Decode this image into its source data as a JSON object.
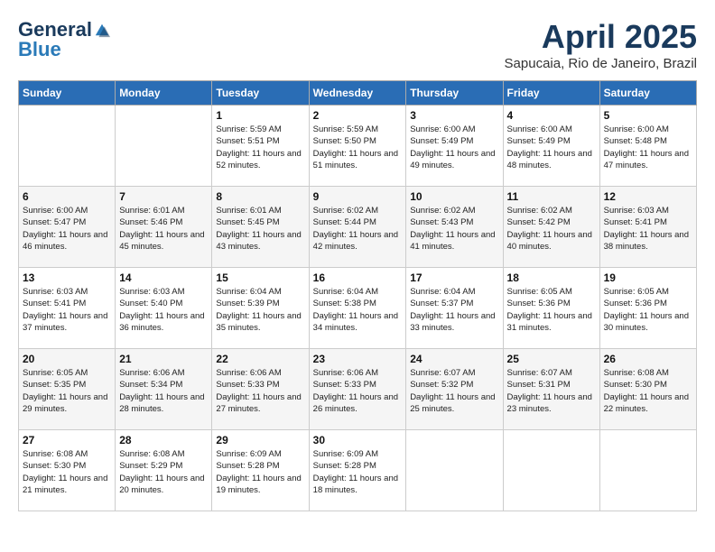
{
  "header": {
    "logo_general": "General",
    "logo_blue": "Blue",
    "month_title": "April 2025",
    "location": "Sapucaia, Rio de Janeiro, Brazil"
  },
  "weekdays": [
    "Sunday",
    "Monday",
    "Tuesday",
    "Wednesday",
    "Thursday",
    "Friday",
    "Saturday"
  ],
  "weeks": [
    [
      {
        "day": "",
        "info": ""
      },
      {
        "day": "",
        "info": ""
      },
      {
        "day": "1",
        "info": "Sunrise: 5:59 AM\nSunset: 5:51 PM\nDaylight: 11 hours and 52 minutes."
      },
      {
        "day": "2",
        "info": "Sunrise: 5:59 AM\nSunset: 5:50 PM\nDaylight: 11 hours and 51 minutes."
      },
      {
        "day": "3",
        "info": "Sunrise: 6:00 AM\nSunset: 5:49 PM\nDaylight: 11 hours and 49 minutes."
      },
      {
        "day": "4",
        "info": "Sunrise: 6:00 AM\nSunset: 5:49 PM\nDaylight: 11 hours and 48 minutes."
      },
      {
        "day": "5",
        "info": "Sunrise: 6:00 AM\nSunset: 5:48 PM\nDaylight: 11 hours and 47 minutes."
      }
    ],
    [
      {
        "day": "6",
        "info": "Sunrise: 6:00 AM\nSunset: 5:47 PM\nDaylight: 11 hours and 46 minutes."
      },
      {
        "day": "7",
        "info": "Sunrise: 6:01 AM\nSunset: 5:46 PM\nDaylight: 11 hours and 45 minutes."
      },
      {
        "day": "8",
        "info": "Sunrise: 6:01 AM\nSunset: 5:45 PM\nDaylight: 11 hours and 43 minutes."
      },
      {
        "day": "9",
        "info": "Sunrise: 6:02 AM\nSunset: 5:44 PM\nDaylight: 11 hours and 42 minutes."
      },
      {
        "day": "10",
        "info": "Sunrise: 6:02 AM\nSunset: 5:43 PM\nDaylight: 11 hours and 41 minutes."
      },
      {
        "day": "11",
        "info": "Sunrise: 6:02 AM\nSunset: 5:42 PM\nDaylight: 11 hours and 40 minutes."
      },
      {
        "day": "12",
        "info": "Sunrise: 6:03 AM\nSunset: 5:41 PM\nDaylight: 11 hours and 38 minutes."
      }
    ],
    [
      {
        "day": "13",
        "info": "Sunrise: 6:03 AM\nSunset: 5:41 PM\nDaylight: 11 hours and 37 minutes."
      },
      {
        "day": "14",
        "info": "Sunrise: 6:03 AM\nSunset: 5:40 PM\nDaylight: 11 hours and 36 minutes."
      },
      {
        "day": "15",
        "info": "Sunrise: 6:04 AM\nSunset: 5:39 PM\nDaylight: 11 hours and 35 minutes."
      },
      {
        "day": "16",
        "info": "Sunrise: 6:04 AM\nSunset: 5:38 PM\nDaylight: 11 hours and 34 minutes."
      },
      {
        "day": "17",
        "info": "Sunrise: 6:04 AM\nSunset: 5:37 PM\nDaylight: 11 hours and 33 minutes."
      },
      {
        "day": "18",
        "info": "Sunrise: 6:05 AM\nSunset: 5:36 PM\nDaylight: 11 hours and 31 minutes."
      },
      {
        "day": "19",
        "info": "Sunrise: 6:05 AM\nSunset: 5:36 PM\nDaylight: 11 hours and 30 minutes."
      }
    ],
    [
      {
        "day": "20",
        "info": "Sunrise: 6:05 AM\nSunset: 5:35 PM\nDaylight: 11 hours and 29 minutes."
      },
      {
        "day": "21",
        "info": "Sunrise: 6:06 AM\nSunset: 5:34 PM\nDaylight: 11 hours and 28 minutes."
      },
      {
        "day": "22",
        "info": "Sunrise: 6:06 AM\nSunset: 5:33 PM\nDaylight: 11 hours and 27 minutes."
      },
      {
        "day": "23",
        "info": "Sunrise: 6:06 AM\nSunset: 5:33 PM\nDaylight: 11 hours and 26 minutes."
      },
      {
        "day": "24",
        "info": "Sunrise: 6:07 AM\nSunset: 5:32 PM\nDaylight: 11 hours and 25 minutes."
      },
      {
        "day": "25",
        "info": "Sunrise: 6:07 AM\nSunset: 5:31 PM\nDaylight: 11 hours and 23 minutes."
      },
      {
        "day": "26",
        "info": "Sunrise: 6:08 AM\nSunset: 5:30 PM\nDaylight: 11 hours and 22 minutes."
      }
    ],
    [
      {
        "day": "27",
        "info": "Sunrise: 6:08 AM\nSunset: 5:30 PM\nDaylight: 11 hours and 21 minutes."
      },
      {
        "day": "28",
        "info": "Sunrise: 6:08 AM\nSunset: 5:29 PM\nDaylight: 11 hours and 20 minutes."
      },
      {
        "day": "29",
        "info": "Sunrise: 6:09 AM\nSunset: 5:28 PM\nDaylight: 11 hours and 19 minutes."
      },
      {
        "day": "30",
        "info": "Sunrise: 6:09 AM\nSunset: 5:28 PM\nDaylight: 11 hours and 18 minutes."
      },
      {
        "day": "",
        "info": ""
      },
      {
        "day": "",
        "info": ""
      },
      {
        "day": "",
        "info": ""
      }
    ]
  ]
}
